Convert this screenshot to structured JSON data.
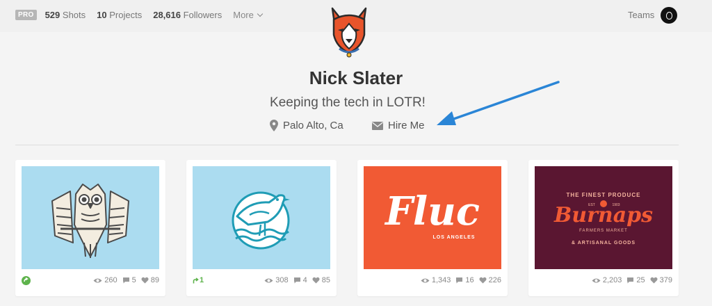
{
  "topbar": {
    "pro_label": "PRO",
    "shots_count": "529",
    "shots_label": "Shots",
    "projects_count": "10",
    "projects_label": "Projects",
    "followers_count": "28,616",
    "followers_label": "Followers",
    "more_label": "More",
    "teams_label": "Teams"
  },
  "profile": {
    "name": "Nick Slater",
    "bio": "Keeping the tech in LOTR!",
    "location": "Palo Alto, Ca",
    "hire_label": "Hire Me"
  },
  "colors": {
    "arrow": "#2a85d6",
    "thumb_blue": "#abdcf0",
    "thumb_orange": "#f15a34",
    "thumb_plum": "#5a1631",
    "rebound_green": "#5eb34c"
  },
  "shots": [
    {
      "image": "owl-illustration",
      "views": "260",
      "comments": "5",
      "likes": "89",
      "rebound": "rebound-icon"
    },
    {
      "image": "bird-badge-illustration",
      "views": "308",
      "comments": "4",
      "likes": "85",
      "rebound_count": "1"
    },
    {
      "image": "fluc-lettering",
      "views": "1,343",
      "comments": "16",
      "likes": "226",
      "text": "Fluc",
      "subtext": "LOS ANGELES"
    },
    {
      "image": "burnaps-lettering",
      "views": "2,203",
      "comments": "25",
      "likes": "379",
      "text": "Burnaps",
      "top_text": "THE FINEST PRODUCE",
      "mid_text": "FARMERS MARKET",
      "bottom_text": "& ARTISANAL GOODS",
      "est_text": "EST",
      "year_text": "1903"
    }
  ]
}
